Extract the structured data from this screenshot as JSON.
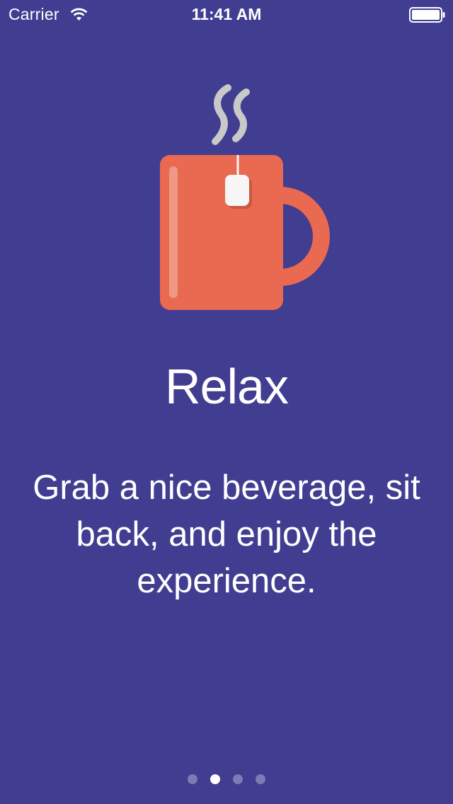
{
  "status_bar": {
    "carrier": "Carrier",
    "time": "11:41 AM",
    "wifi_icon": "wifi-icon",
    "battery_icon": "battery-icon"
  },
  "illustration": {
    "icon": "tea-mug-icon",
    "steam_icon": "steam-icon",
    "mug_color": "#E96A50",
    "tag_color": "#F6F6F6",
    "steam_color": "#C9C9C9"
  },
  "onboarding": {
    "title": "Relax",
    "description": "Grab a nice beverage, sit back, and enjoy the experience."
  },
  "page_control": {
    "pages": 4,
    "current_index": 1
  },
  "colors": {
    "background": "#413D91",
    "text": "#FFFFFF",
    "dot_active": "#FFFFFF",
    "dot_inactive": "#7E7AB4"
  }
}
